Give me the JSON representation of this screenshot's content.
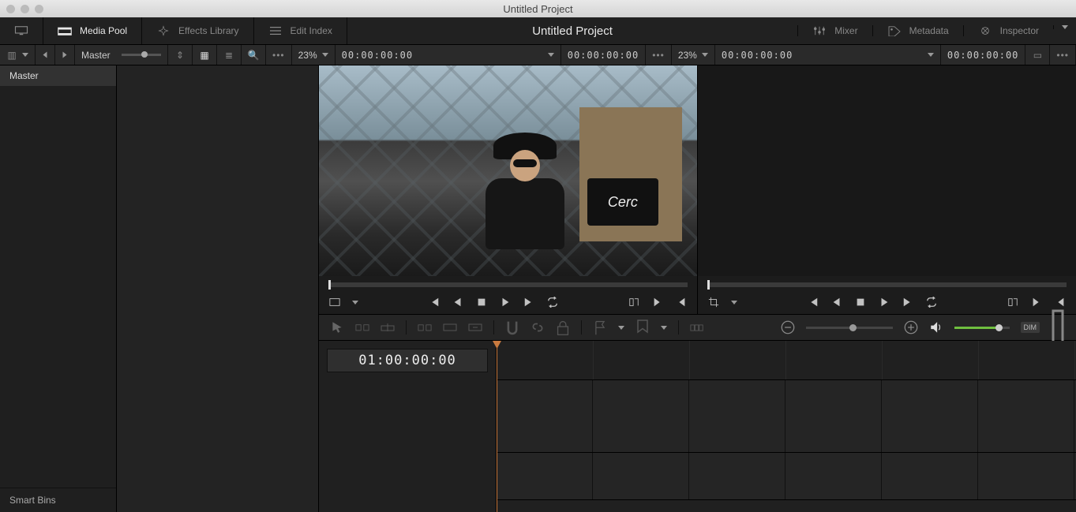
{
  "window": {
    "title": "Untitled Project"
  },
  "topbar": {
    "media_pool": "Media Pool",
    "effects_library": "Effects Library",
    "edit_index": "Edit Index",
    "project_title": "Untitled Project",
    "mixer": "Mixer",
    "metadata": "Metadata",
    "inspector": "Inspector"
  },
  "subbar": {
    "bin": "Master",
    "zoom_left": "23%",
    "tc_left_in": "00:00:00:00",
    "tc_left_out": "00:00:00:00",
    "zoom_right": "23%",
    "tc_right_in": "00:00:00:00",
    "tc_right_out": "00:00:00:00"
  },
  "sidebar": {
    "master": "Master",
    "smart_bins": "Smart Bins"
  },
  "source_viewer": {
    "sign": "Cerc"
  },
  "timeline": {
    "timecode": "01:00:00:00"
  },
  "dim_label": "DIM"
}
